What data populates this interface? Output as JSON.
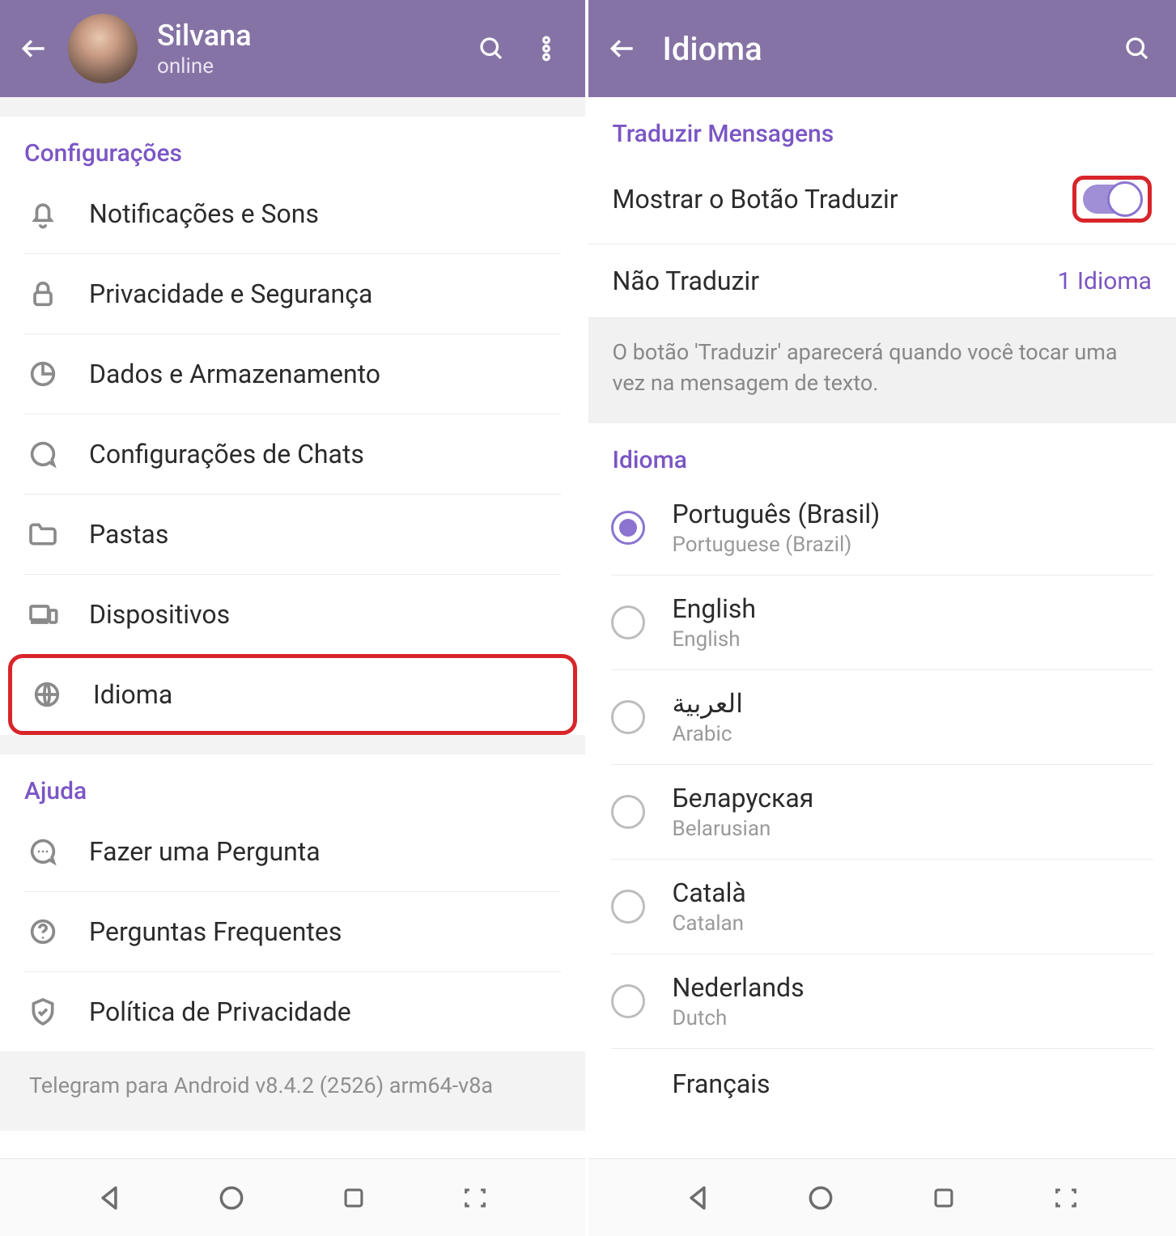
{
  "left": {
    "header": {
      "name": "Silvana",
      "status": "online"
    },
    "sections": {
      "config_title": "Configurações",
      "items": [
        {
          "label": "Notificações e Sons",
          "icon": "bell"
        },
        {
          "label": "Privacidade e Segurança",
          "icon": "lock"
        },
        {
          "label": "Dados e Armazenamento",
          "icon": "pie"
        },
        {
          "label": "Configurações de Chats",
          "icon": "chat"
        },
        {
          "label": "Pastas",
          "icon": "folder"
        },
        {
          "label": "Dispositivos",
          "icon": "devices"
        },
        {
          "label": "Idioma",
          "icon": "globe",
          "highlighted": true
        }
      ],
      "help_title": "Ajuda",
      "help_items": [
        {
          "label": "Fazer uma Pergunta",
          "icon": "chat-dots"
        },
        {
          "label": "Perguntas Frequentes",
          "icon": "question"
        },
        {
          "label": "Política de Privacidade",
          "icon": "shield"
        }
      ]
    },
    "footer": "Telegram para Android v8.4.2 (2526) arm64-v8a"
  },
  "right": {
    "title": "Idioma",
    "translate_section": "Traduzir Mensagens",
    "show_button_label": "Mostrar o Botão Traduzir",
    "dont_translate_label": "Não Traduzir",
    "dont_translate_value": "1 Idioma",
    "info": "O botão 'Traduzir' aparecerá quando você tocar uma vez na mensagem de texto.",
    "lang_section": "Idioma",
    "languages": [
      {
        "name": "Português (Brasil)",
        "sub": "Portuguese (Brazil)",
        "selected": true
      },
      {
        "name": "English",
        "sub": "English",
        "selected": false
      },
      {
        "name": "العربية",
        "sub": "Arabic",
        "selected": false
      },
      {
        "name": "Беларуская",
        "sub": "Belarusian",
        "selected": false
      },
      {
        "name": "Català",
        "sub": "Catalan",
        "selected": false
      },
      {
        "name": "Nederlands",
        "sub": "Dutch",
        "selected": false
      },
      {
        "name": "Français",
        "sub": "",
        "selected": false
      }
    ]
  }
}
